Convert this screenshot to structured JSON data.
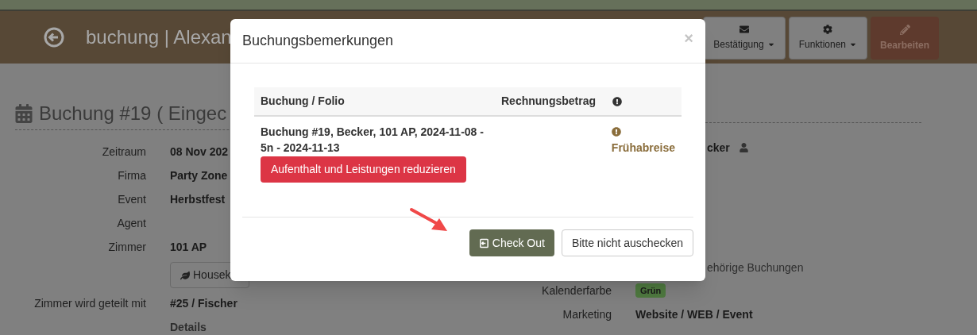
{
  "header": {
    "title": "buchung | Alexan",
    "buttons": [
      {
        "label": "Bestätigung",
        "kind": "dropdown"
      },
      {
        "label": "Funktionen",
        "kind": "dropdown"
      },
      {
        "label": "Bearbeiten",
        "kind": "primary"
      }
    ]
  },
  "booking": {
    "title": "Buchung #19 ( Eingec",
    "fields": [
      {
        "kind": "text",
        "label": "Zeitraum",
        "value": "08 Nov 202"
      },
      {
        "kind": "text",
        "label": "Firma",
        "value": "Party Zone"
      },
      {
        "kind": "text",
        "label": "Event",
        "value": "Herbstfest"
      },
      {
        "kind": "text",
        "label": "Agent"
      },
      {
        "kind": "text",
        "label": "Zimmer",
        "value": "101 AP"
      },
      {
        "kind": "button",
        "value": "Housek"
      },
      {
        "kind": "text",
        "label": "Zimmer wird geteilt mit",
        "value": "#25 / Fischer"
      },
      {
        "kind": "link",
        "value": "Details"
      }
    ],
    "side_fields": [
      {
        "kind": "guest",
        "value": "cker"
      },
      {
        "kind": "plain",
        "value": "ehörige Buchungen"
      },
      {
        "kind": "badge",
        "label": "Kalenderfarbe",
        "value": "Grün"
      },
      {
        "kind": "text",
        "label": "Marketing",
        "value": "Website / WEB / Event"
      }
    ]
  },
  "modal": {
    "title": "Buchungsbemerkungen",
    "close": "×",
    "columns": [
      "Buchung / Folio",
      "Rechnungsbetrag"
    ],
    "rows": [
      {
        "booking": "Buchung #19, Becker, 101 AP, 2024-11-08 - 5n - 2024-11-13",
        "action": "Aufenthalt und Leistungen reduzieren",
        "status": "Frühabreise"
      }
    ],
    "buttons": [
      {
        "label": "Check Out",
        "kind": "primary"
      },
      {
        "label": "Bitte nicht auschecken",
        "kind": "default"
      }
    ]
  }
}
